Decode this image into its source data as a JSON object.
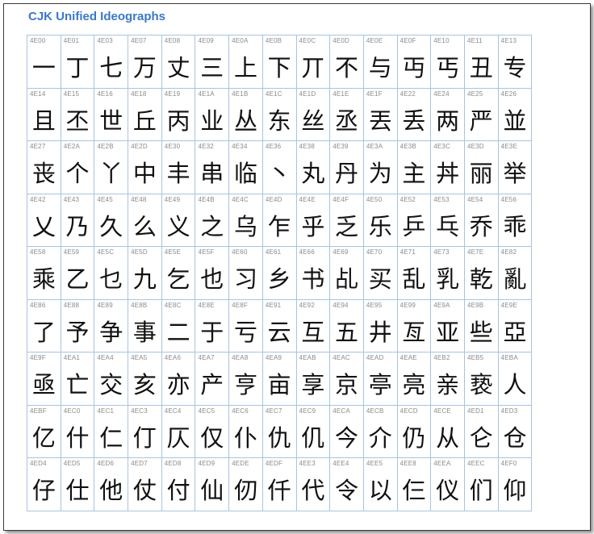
{
  "title": "CJK Unified Ideographs",
  "columns": 15,
  "cells": [
    {
      "code": "4E00",
      "char": "一"
    },
    {
      "code": "4E01",
      "char": "丁"
    },
    {
      "code": "4E03",
      "char": "七"
    },
    {
      "code": "4E07",
      "char": "万"
    },
    {
      "code": "4E08",
      "char": "丈"
    },
    {
      "code": "4E09",
      "char": "三"
    },
    {
      "code": "4E0A",
      "char": "上"
    },
    {
      "code": "4E0B",
      "char": "下"
    },
    {
      "code": "4E0C",
      "char": "丌"
    },
    {
      "code": "4E0D",
      "char": "不"
    },
    {
      "code": "4E0E",
      "char": "与"
    },
    {
      "code": "4E0F",
      "char": "丏"
    },
    {
      "code": "4E10",
      "char": "丐"
    },
    {
      "code": "4E11",
      "char": "丑"
    },
    {
      "code": "4E13",
      "char": "专"
    },
    {
      "code": "4E14",
      "char": "且"
    },
    {
      "code": "4E15",
      "char": "丕"
    },
    {
      "code": "4E16",
      "char": "世"
    },
    {
      "code": "4E18",
      "char": "丘"
    },
    {
      "code": "4E19",
      "char": "丙"
    },
    {
      "code": "4E1A",
      "char": "业"
    },
    {
      "code": "4E1B",
      "char": "丛"
    },
    {
      "code": "4E1C",
      "char": "东"
    },
    {
      "code": "4E1D",
      "char": "丝"
    },
    {
      "code": "4E1E",
      "char": "丞"
    },
    {
      "code": "4E1F",
      "char": "丟"
    },
    {
      "code": "4E22",
      "char": "丢"
    },
    {
      "code": "4E24",
      "char": "两"
    },
    {
      "code": "4E25",
      "char": "严"
    },
    {
      "code": "4E26",
      "char": "並"
    },
    {
      "code": "4E27",
      "char": "丧"
    },
    {
      "code": "4E2A",
      "char": "个"
    },
    {
      "code": "4E2B",
      "char": "丫"
    },
    {
      "code": "4E2D",
      "char": "中"
    },
    {
      "code": "4E30",
      "char": "丰"
    },
    {
      "code": "4E32",
      "char": "串"
    },
    {
      "code": "4E34",
      "char": "临"
    },
    {
      "code": "4E36",
      "char": "丶"
    },
    {
      "code": "4E38",
      "char": "丸"
    },
    {
      "code": "4E39",
      "char": "丹"
    },
    {
      "code": "4E3A",
      "char": "为"
    },
    {
      "code": "4E3B",
      "char": "主"
    },
    {
      "code": "4E3C",
      "char": "丼"
    },
    {
      "code": "4E3D",
      "char": "丽"
    },
    {
      "code": "4E3E",
      "char": "举"
    },
    {
      "code": "4E42",
      "char": "乂"
    },
    {
      "code": "4E43",
      "char": "乃"
    },
    {
      "code": "4E45",
      "char": "久"
    },
    {
      "code": "4E48",
      "char": "么"
    },
    {
      "code": "4E49",
      "char": "义"
    },
    {
      "code": "4E4B",
      "char": "之"
    },
    {
      "code": "4E4C",
      "char": "乌"
    },
    {
      "code": "4E4D",
      "char": "乍"
    },
    {
      "code": "4E4E",
      "char": "乎"
    },
    {
      "code": "4E4F",
      "char": "乏"
    },
    {
      "code": "4E50",
      "char": "乐"
    },
    {
      "code": "4E52",
      "char": "乒"
    },
    {
      "code": "4E53",
      "char": "乓"
    },
    {
      "code": "4E54",
      "char": "乔"
    },
    {
      "code": "4E56",
      "char": "乖"
    },
    {
      "code": "4E58",
      "char": "乘"
    },
    {
      "code": "4E59",
      "char": "乙"
    },
    {
      "code": "4E5C",
      "char": "乜"
    },
    {
      "code": "4E5D",
      "char": "九"
    },
    {
      "code": "4E5E",
      "char": "乞"
    },
    {
      "code": "4E5F",
      "char": "也"
    },
    {
      "code": "4E60",
      "char": "习"
    },
    {
      "code": "4E61",
      "char": "乡"
    },
    {
      "code": "4E66",
      "char": "书"
    },
    {
      "code": "4E69",
      "char": "乩"
    },
    {
      "code": "4E70",
      "char": "买"
    },
    {
      "code": "4E71",
      "char": "乱"
    },
    {
      "code": "4E73",
      "char": "乳"
    },
    {
      "code": "4E7E",
      "char": "乾"
    },
    {
      "code": "4E82",
      "char": "亂"
    },
    {
      "code": "4E86",
      "char": "了"
    },
    {
      "code": "4E88",
      "char": "予"
    },
    {
      "code": "4E89",
      "char": "争"
    },
    {
      "code": "4E8B",
      "char": "事"
    },
    {
      "code": "4E8C",
      "char": "二"
    },
    {
      "code": "4E8E",
      "char": "于"
    },
    {
      "code": "4E8F",
      "char": "亏"
    },
    {
      "code": "4E91",
      "char": "云"
    },
    {
      "code": "4E92",
      "char": "互"
    },
    {
      "code": "4E94",
      "char": "五"
    },
    {
      "code": "4E95",
      "char": "井"
    },
    {
      "code": "4E99",
      "char": "亙"
    },
    {
      "code": "4E9A",
      "char": "亚"
    },
    {
      "code": "4E9B",
      "char": "些"
    },
    {
      "code": "4E9E",
      "char": "亞"
    },
    {
      "code": "4E9F",
      "char": "亟"
    },
    {
      "code": "4EA1",
      "char": "亡"
    },
    {
      "code": "4EA4",
      "char": "交"
    },
    {
      "code": "4EA5",
      "char": "亥"
    },
    {
      "code": "4EA6",
      "char": "亦"
    },
    {
      "code": "4EA7",
      "char": "产"
    },
    {
      "code": "4EA8",
      "char": "亨"
    },
    {
      "code": "4EA9",
      "char": "亩"
    },
    {
      "code": "4EAB",
      "char": "享"
    },
    {
      "code": "4EAC",
      "char": "京"
    },
    {
      "code": "4EAD",
      "char": "亭"
    },
    {
      "code": "4EAE",
      "char": "亮"
    },
    {
      "code": "4EB2",
      "char": "亲"
    },
    {
      "code": "4EB5",
      "char": "亵"
    },
    {
      "code": "4EBA",
      "char": "人"
    },
    {
      "code": "4EBF",
      "char": "亿"
    },
    {
      "code": "4EC0",
      "char": "什"
    },
    {
      "code": "4EC1",
      "char": "仁"
    },
    {
      "code": "4EC3",
      "char": "仃"
    },
    {
      "code": "4EC4",
      "char": "仄"
    },
    {
      "code": "4EC5",
      "char": "仅"
    },
    {
      "code": "4EC6",
      "char": "仆"
    },
    {
      "code": "4EC7",
      "char": "仇"
    },
    {
      "code": "4EC9",
      "char": "仉"
    },
    {
      "code": "4ECA",
      "char": "今"
    },
    {
      "code": "4ECB",
      "char": "介"
    },
    {
      "code": "4ECD",
      "char": "仍"
    },
    {
      "code": "4ECE",
      "char": "从"
    },
    {
      "code": "4ED1",
      "char": "仑"
    },
    {
      "code": "4ED3",
      "char": "仓"
    },
    {
      "code": "4ED4",
      "char": "仔"
    },
    {
      "code": "4ED5",
      "char": "仕"
    },
    {
      "code": "4ED6",
      "char": "他"
    },
    {
      "code": "4ED7",
      "char": "仗"
    },
    {
      "code": "4ED8",
      "char": "付"
    },
    {
      "code": "4ED9",
      "char": "仙"
    },
    {
      "code": "4EDE",
      "char": "仞"
    },
    {
      "code": "4EDF",
      "char": "仟"
    },
    {
      "code": "4EE3",
      "char": "代"
    },
    {
      "code": "4EE4",
      "char": "令"
    },
    {
      "code": "4EE5",
      "char": "以"
    },
    {
      "code": "4EE8",
      "char": "仨"
    },
    {
      "code": "4EEA",
      "char": "仪"
    },
    {
      "code": "4EEC",
      "char": "们"
    },
    {
      "code": "4EF0",
      "char": "仰"
    }
  ]
}
